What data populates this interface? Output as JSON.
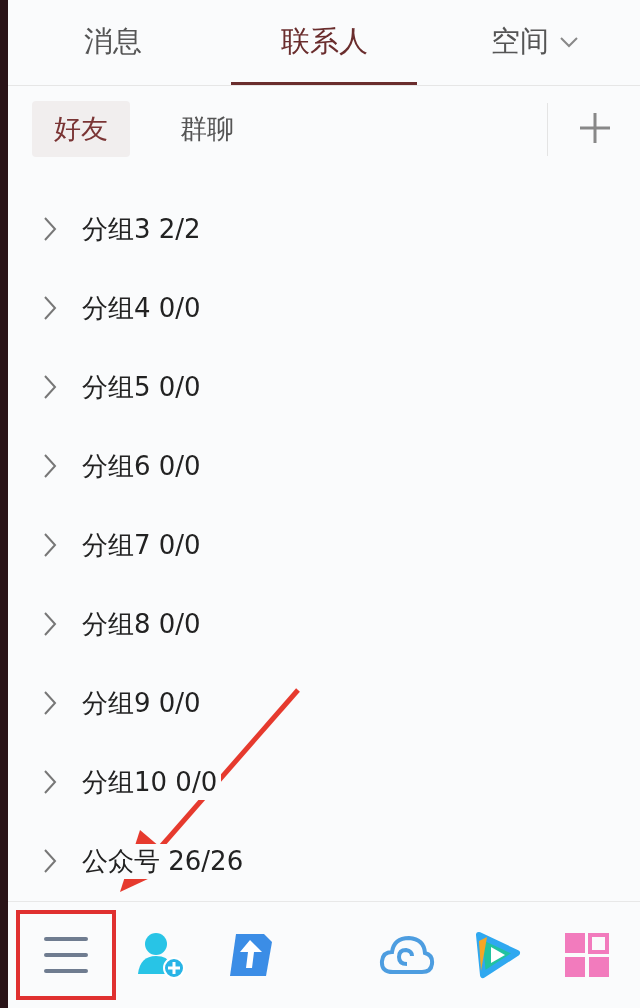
{
  "tabs": [
    {
      "label": "消息",
      "selected": false
    },
    {
      "label": "联系人",
      "selected": true
    },
    {
      "label": "空间",
      "selected": false,
      "dropdown": true
    }
  ],
  "subtabs": [
    {
      "label": "好友",
      "selected": true
    },
    {
      "label": "群聊",
      "selected": false
    }
  ],
  "groups": [
    {
      "name": "分组3",
      "count": "2/2",
      "expanded": false
    },
    {
      "name": "分组4",
      "count": "0/0",
      "expanded": false
    },
    {
      "name": "分组5",
      "count": "0/0",
      "expanded": false
    },
    {
      "name": "分组6",
      "count": "0/0",
      "expanded": false
    },
    {
      "name": "分组7",
      "count": "0/0",
      "expanded": false
    },
    {
      "name": "分组8",
      "count": "0/0",
      "expanded": false
    },
    {
      "name": "分组9",
      "count": "0/0",
      "expanded": false
    },
    {
      "name": "分组10",
      "count": "0/0",
      "expanded": false
    },
    {
      "name": "公众号",
      "count": "26/26",
      "expanded": false
    }
  ],
  "toolbar": [
    {
      "kind": "menu",
      "highlighted": true
    },
    {
      "kind": "add-contact",
      "highlighted": false
    },
    {
      "kind": "transfer",
      "highlighted": false
    },
    {
      "kind": "cloud",
      "highlighted": false
    },
    {
      "kind": "video",
      "highlighted": false
    },
    {
      "kind": "apps",
      "highlighted": false
    }
  ],
  "annotations": [
    {
      "kind": "arrow"
    }
  ]
}
